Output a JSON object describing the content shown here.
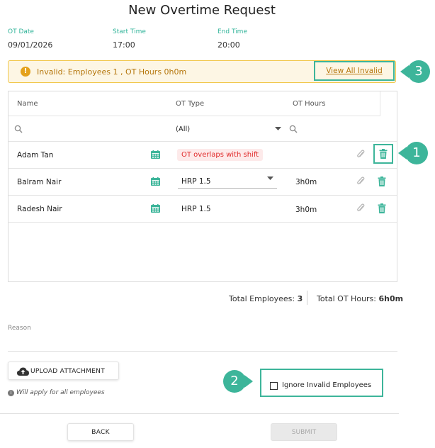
{
  "page": {
    "title": "New Overtime Request"
  },
  "meta": {
    "ot_date_label": "OT Date",
    "ot_date_value": "09/01/2026",
    "start_label": "Start Time",
    "start_value": "17:00",
    "end_label": "End Time",
    "end_value": "20:00"
  },
  "banner": {
    "text": "Invalid: Employees 1 , OT Hours 0h0m",
    "link": "View All Invalid",
    "icon": "warning-icon"
  },
  "callouts": {
    "one": "1",
    "two": "2",
    "three": "3"
  },
  "grid": {
    "headers": {
      "name": "Name",
      "ot_type": "OT Type",
      "ot_hours": "OT Hours"
    },
    "filter": {
      "ot_type_value": "(All)"
    },
    "rows": [
      {
        "name": "Adam Tan",
        "ot_type": "",
        "ot_hours": "",
        "error": "OT overlaps with shift"
      },
      {
        "name": "Balram Nair",
        "ot_type": "HRP 1.5",
        "ot_hours": "3h0m",
        "error": ""
      },
      {
        "name": "Radesh Nair",
        "ot_type": "HRP 1.5",
        "ot_hours": "3h0m",
        "error": ""
      }
    ]
  },
  "totals": {
    "employees_label": "Total Employees: ",
    "employees_value": "3",
    "hours_label": "Total OT Hours: ",
    "hours_value": "6h0m"
  },
  "reason": {
    "label": "Reason"
  },
  "attachment": {
    "button": "UPLOAD ATTACHMENT",
    "note": "Will apply for all employees"
  },
  "ignore": {
    "label": "Ignore Invalid Employees",
    "checked": false
  },
  "footer": {
    "back": "BACK",
    "submit": "SUBMIT"
  },
  "colors": {
    "accent": "#3db59a",
    "warning_bg": "#fdf6e4",
    "warning_text": "#b5760c",
    "error": "#e02b2b"
  }
}
